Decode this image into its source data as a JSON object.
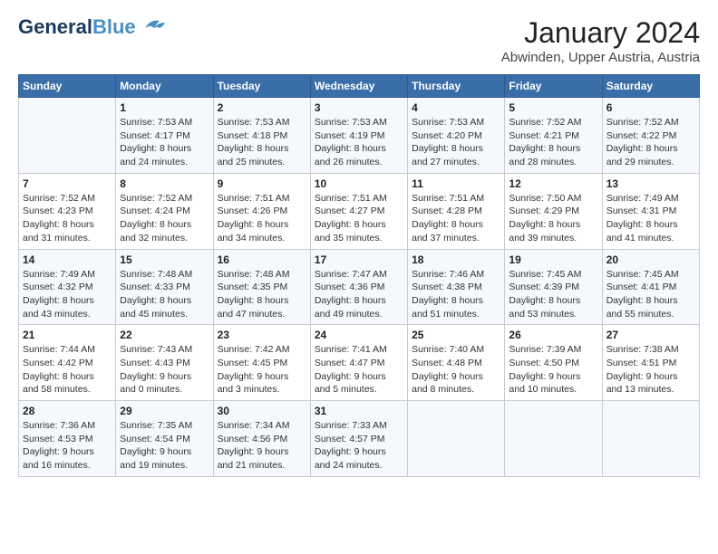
{
  "header": {
    "logo_line1": "General",
    "logo_line2": "Blue",
    "title": "January 2024",
    "subtitle": "Abwinden, Upper Austria, Austria"
  },
  "days_of_week": [
    "Sunday",
    "Monday",
    "Tuesday",
    "Wednesday",
    "Thursday",
    "Friday",
    "Saturday"
  ],
  "weeks": [
    [
      {
        "date": "",
        "lines": []
      },
      {
        "date": "1",
        "lines": [
          "Sunrise: 7:53 AM",
          "Sunset: 4:17 PM",
          "Daylight: 8 hours",
          "and 24 minutes."
        ]
      },
      {
        "date": "2",
        "lines": [
          "Sunrise: 7:53 AM",
          "Sunset: 4:18 PM",
          "Daylight: 8 hours",
          "and 25 minutes."
        ]
      },
      {
        "date": "3",
        "lines": [
          "Sunrise: 7:53 AM",
          "Sunset: 4:19 PM",
          "Daylight: 8 hours",
          "and 26 minutes."
        ]
      },
      {
        "date": "4",
        "lines": [
          "Sunrise: 7:53 AM",
          "Sunset: 4:20 PM",
          "Daylight: 8 hours",
          "and 27 minutes."
        ]
      },
      {
        "date": "5",
        "lines": [
          "Sunrise: 7:52 AM",
          "Sunset: 4:21 PM",
          "Daylight: 8 hours",
          "and 28 minutes."
        ]
      },
      {
        "date": "6",
        "lines": [
          "Sunrise: 7:52 AM",
          "Sunset: 4:22 PM",
          "Daylight: 8 hours",
          "and 29 minutes."
        ]
      }
    ],
    [
      {
        "date": "7",
        "lines": [
          "Sunrise: 7:52 AM",
          "Sunset: 4:23 PM",
          "Daylight: 8 hours",
          "and 31 minutes."
        ]
      },
      {
        "date": "8",
        "lines": [
          "Sunrise: 7:52 AM",
          "Sunset: 4:24 PM",
          "Daylight: 8 hours",
          "and 32 minutes."
        ]
      },
      {
        "date": "9",
        "lines": [
          "Sunrise: 7:51 AM",
          "Sunset: 4:26 PM",
          "Daylight: 8 hours",
          "and 34 minutes."
        ]
      },
      {
        "date": "10",
        "lines": [
          "Sunrise: 7:51 AM",
          "Sunset: 4:27 PM",
          "Daylight: 8 hours",
          "and 35 minutes."
        ]
      },
      {
        "date": "11",
        "lines": [
          "Sunrise: 7:51 AM",
          "Sunset: 4:28 PM",
          "Daylight: 8 hours",
          "and 37 minutes."
        ]
      },
      {
        "date": "12",
        "lines": [
          "Sunrise: 7:50 AM",
          "Sunset: 4:29 PM",
          "Daylight: 8 hours",
          "and 39 minutes."
        ]
      },
      {
        "date": "13",
        "lines": [
          "Sunrise: 7:49 AM",
          "Sunset: 4:31 PM",
          "Daylight: 8 hours",
          "and 41 minutes."
        ]
      }
    ],
    [
      {
        "date": "14",
        "lines": [
          "Sunrise: 7:49 AM",
          "Sunset: 4:32 PM",
          "Daylight: 8 hours",
          "and 43 minutes."
        ]
      },
      {
        "date": "15",
        "lines": [
          "Sunrise: 7:48 AM",
          "Sunset: 4:33 PM",
          "Daylight: 8 hours",
          "and 45 minutes."
        ]
      },
      {
        "date": "16",
        "lines": [
          "Sunrise: 7:48 AM",
          "Sunset: 4:35 PM",
          "Daylight: 8 hours",
          "and 47 minutes."
        ]
      },
      {
        "date": "17",
        "lines": [
          "Sunrise: 7:47 AM",
          "Sunset: 4:36 PM",
          "Daylight: 8 hours",
          "and 49 minutes."
        ]
      },
      {
        "date": "18",
        "lines": [
          "Sunrise: 7:46 AM",
          "Sunset: 4:38 PM",
          "Daylight: 8 hours",
          "and 51 minutes."
        ]
      },
      {
        "date": "19",
        "lines": [
          "Sunrise: 7:45 AM",
          "Sunset: 4:39 PM",
          "Daylight: 8 hours",
          "and 53 minutes."
        ]
      },
      {
        "date": "20",
        "lines": [
          "Sunrise: 7:45 AM",
          "Sunset: 4:41 PM",
          "Daylight: 8 hours",
          "and 55 minutes."
        ]
      }
    ],
    [
      {
        "date": "21",
        "lines": [
          "Sunrise: 7:44 AM",
          "Sunset: 4:42 PM",
          "Daylight: 8 hours",
          "and 58 minutes."
        ]
      },
      {
        "date": "22",
        "lines": [
          "Sunrise: 7:43 AM",
          "Sunset: 4:43 PM",
          "Daylight: 9 hours",
          "and 0 minutes."
        ]
      },
      {
        "date": "23",
        "lines": [
          "Sunrise: 7:42 AM",
          "Sunset: 4:45 PM",
          "Daylight: 9 hours",
          "and 3 minutes."
        ]
      },
      {
        "date": "24",
        "lines": [
          "Sunrise: 7:41 AM",
          "Sunset: 4:47 PM",
          "Daylight: 9 hours",
          "and 5 minutes."
        ]
      },
      {
        "date": "25",
        "lines": [
          "Sunrise: 7:40 AM",
          "Sunset: 4:48 PM",
          "Daylight: 9 hours",
          "and 8 minutes."
        ]
      },
      {
        "date": "26",
        "lines": [
          "Sunrise: 7:39 AM",
          "Sunset: 4:50 PM",
          "Daylight: 9 hours",
          "and 10 minutes."
        ]
      },
      {
        "date": "27",
        "lines": [
          "Sunrise: 7:38 AM",
          "Sunset: 4:51 PM",
          "Daylight: 9 hours",
          "and 13 minutes."
        ]
      }
    ],
    [
      {
        "date": "28",
        "lines": [
          "Sunrise: 7:36 AM",
          "Sunset: 4:53 PM",
          "Daylight: 9 hours",
          "and 16 minutes."
        ]
      },
      {
        "date": "29",
        "lines": [
          "Sunrise: 7:35 AM",
          "Sunset: 4:54 PM",
          "Daylight: 9 hours",
          "and 19 minutes."
        ]
      },
      {
        "date": "30",
        "lines": [
          "Sunrise: 7:34 AM",
          "Sunset: 4:56 PM",
          "Daylight: 9 hours",
          "and 21 minutes."
        ]
      },
      {
        "date": "31",
        "lines": [
          "Sunrise: 7:33 AM",
          "Sunset: 4:57 PM",
          "Daylight: 9 hours",
          "and 24 minutes."
        ]
      },
      {
        "date": "",
        "lines": []
      },
      {
        "date": "",
        "lines": []
      },
      {
        "date": "",
        "lines": []
      }
    ]
  ]
}
